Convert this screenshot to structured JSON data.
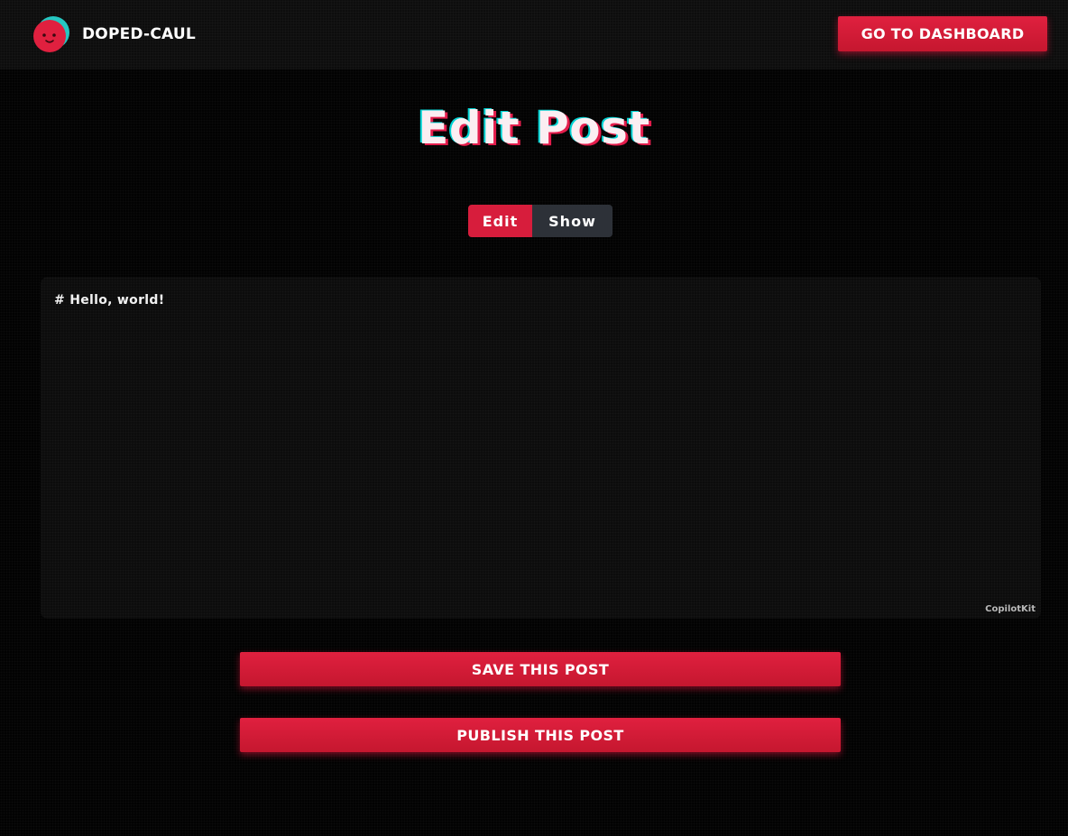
{
  "header": {
    "brand": "DOPED-CAUL",
    "logo_icon": "smiley-face-logo-icon",
    "dashboard_button": "GO TO DASHBOARD"
  },
  "page": {
    "title": "Edit Post"
  },
  "mode_toggle": {
    "edit_label": "Edit",
    "show_label": "Show",
    "active": "Edit"
  },
  "editor": {
    "value": "# Hello, world!",
    "watermark": "CopilotKit"
  },
  "actions": {
    "save_label": "SAVE THIS POST",
    "publish_label": "PUBLISH THIS POST"
  },
  "colors": {
    "accent": "#d71d3c",
    "toggle_inactive": "#2d3138",
    "title_cyan_shadow": "#00ebeb",
    "title_red_shadow": "#f01e50"
  }
}
